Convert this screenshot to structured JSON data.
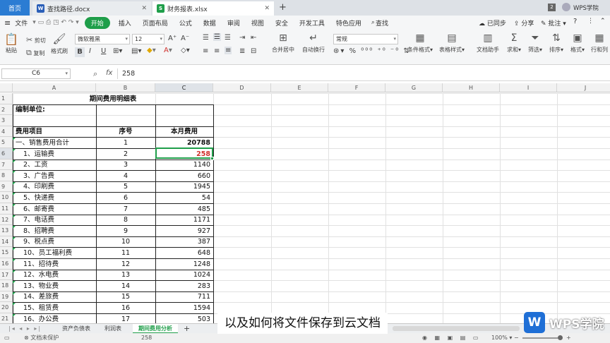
{
  "tabs": [
    {
      "label": "首页",
      "active": true
    },
    {
      "label": "查找路径.docx",
      "icon": "W"
    },
    {
      "label": "财务报表.xlsx",
      "icon": "S"
    }
  ],
  "tabbar_right": {
    "badge": "2",
    "account": "WPS学院"
  },
  "menu": {
    "file": "文件",
    "start": "开始",
    "items": [
      "插入",
      "页面布局",
      "公式",
      "数据",
      "审阅",
      "视图",
      "安全",
      "开发工具",
      "特色应用"
    ],
    "search": "查找",
    "sync": "已同步",
    "share": "分享",
    "comment": "批注",
    "help": "?"
  },
  "ribbon": {
    "paste": "粘贴",
    "cut": "剪切",
    "copy": "复制",
    "format_painter": "格式刷",
    "font_name": "微软雅黑",
    "font_size": "12",
    "bold": "B",
    "italic": "I",
    "underline": "U",
    "merge": "合并居中",
    "wrap": "自动换行",
    "number_format": "常规",
    "cond_format": "条件格式",
    "table_style": "表格样式",
    "doc_helper": "文档助手",
    "sum": "求和",
    "filter": "筛选",
    "sort": "排序",
    "format": "格式",
    "row_col": "行和列"
  },
  "formula_bar": {
    "cell_ref": "C6",
    "fx": "fx",
    "value": "258"
  },
  "columns": [
    "A",
    "B",
    "C",
    "D",
    "E",
    "F",
    "G",
    "H",
    "I",
    "J"
  ],
  "rows": [
    "1",
    "2",
    "3",
    "4",
    "5",
    "6",
    "7",
    "8",
    "9",
    "10",
    "11",
    "12",
    "13",
    "14",
    "15",
    "16",
    "17",
    "18",
    "19",
    "20",
    "21"
  ],
  "table": {
    "title": "期间费用明细表",
    "unit_label": "编制单位:",
    "headers": [
      "费用项目",
      "序号",
      "本月费用"
    ],
    "data": [
      [
        "一、销售费用合计",
        "1",
        "20788"
      ],
      [
        "1、运输费",
        "2",
        "258"
      ],
      [
        "2、工资",
        "3",
        "1140"
      ],
      [
        "3、广告费",
        "4",
        "660"
      ],
      [
        "4、印刷费",
        "5",
        "1945"
      ],
      [
        "5、快递费",
        "6",
        "54"
      ],
      [
        "6、邮寄费",
        "7",
        "485"
      ],
      [
        "7、电话费",
        "8",
        "1171"
      ],
      [
        "8、招聘费",
        "9",
        "927"
      ],
      [
        "9、税点费",
        "10",
        "387"
      ],
      [
        "10、员工福利费",
        "11",
        "648"
      ],
      [
        "11、招待费",
        "12",
        "1248"
      ],
      [
        "12、水电费",
        "13",
        "1024"
      ],
      [
        "13、物业费",
        "14",
        "283"
      ],
      [
        "14、差旅费",
        "15",
        "711"
      ],
      [
        "15、租赁费",
        "16",
        "1594"
      ],
      [
        "16、办公费",
        "17",
        "503"
      ]
    ]
  },
  "sheets": [
    "资产负债表",
    "利润表",
    "期间费用分析"
  ],
  "active_sheet": "期间费用分析",
  "status": {
    "protect": "文档未保护",
    "sum_value": "258",
    "zoom": "100%"
  },
  "subtitle": "以及如何将文件保存到云文档",
  "logo_text": "WPS学院",
  "colors": {
    "accent": "#1f9e4a",
    "tab_home": "#2b7cd3",
    "red_value": "#d0312d",
    "logo_blue": "#1f6fd6"
  }
}
